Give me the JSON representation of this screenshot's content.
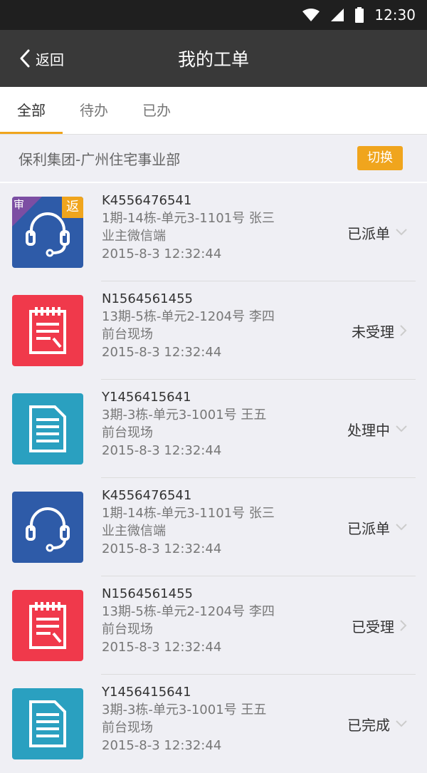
{
  "statusbar": {
    "time": "12:30",
    "icons": [
      "wifi-icon",
      "signal-icon",
      "battery-icon"
    ]
  },
  "nav": {
    "back_label": "返回",
    "title": "我的工单"
  },
  "tabs": [
    {
      "label": "全部",
      "active": true
    },
    {
      "label": "待办",
      "active": false
    },
    {
      "label": "已办",
      "active": false
    }
  ],
  "org": {
    "name": "保利集团-广州住宅事业部",
    "switch_label": "切换"
  },
  "orders": [
    {
      "code": "K4556476541",
      "address": "1期-14栋-单元3-1101号 张三",
      "source": "业主微信端",
      "time": "2015-8-3  12:32:44",
      "status": "已派单",
      "icon": "headset-icon",
      "color": "#2e5ba8",
      "badges": {
        "shen": "审",
        "fan": "返"
      },
      "arrow": "down"
    },
    {
      "code": "N1564561455",
      "address": "13期-5栋-单元2-1204号 李四",
      "source": "前台现场",
      "time": "2015-8-3  12:32:44",
      "status": "未受理",
      "icon": "notepad-icon",
      "color": "#f0394b",
      "arrow": "right"
    },
    {
      "code": "Y1456415641",
      "address": "3期-3栋-单元3-1001号 王五",
      "source": "前台现场",
      "time": "2015-8-3  12:32:44",
      "status": "处理中",
      "icon": "document-icon",
      "color": "#2aa0c0",
      "arrow": "down"
    },
    {
      "code": "K4556476541",
      "address": "1期-14栋-单元3-1101号 张三",
      "source": "业主微信端",
      "time": "2015-8-3  12:32:44",
      "status": "已派单",
      "icon": "headset-icon",
      "color": "#2e5ba8",
      "arrow": "down"
    },
    {
      "code": "N1564561455",
      "address": "13期-5栋-单元2-1204号 李四",
      "source": "前台现场",
      "time": "2015-8-3  12:32:44",
      "status": "已受理",
      "icon": "notepad-icon",
      "color": "#f0394b",
      "arrow": "right"
    },
    {
      "code": "Y1456415641",
      "address": "3期-3栋-单元3-1001号 王五",
      "source": "前台现场",
      "time": "2015-8-3  12:32:44",
      "status": "已完成",
      "icon": "document-icon",
      "color": "#2aa0c0",
      "arrow": "down"
    }
  ]
}
